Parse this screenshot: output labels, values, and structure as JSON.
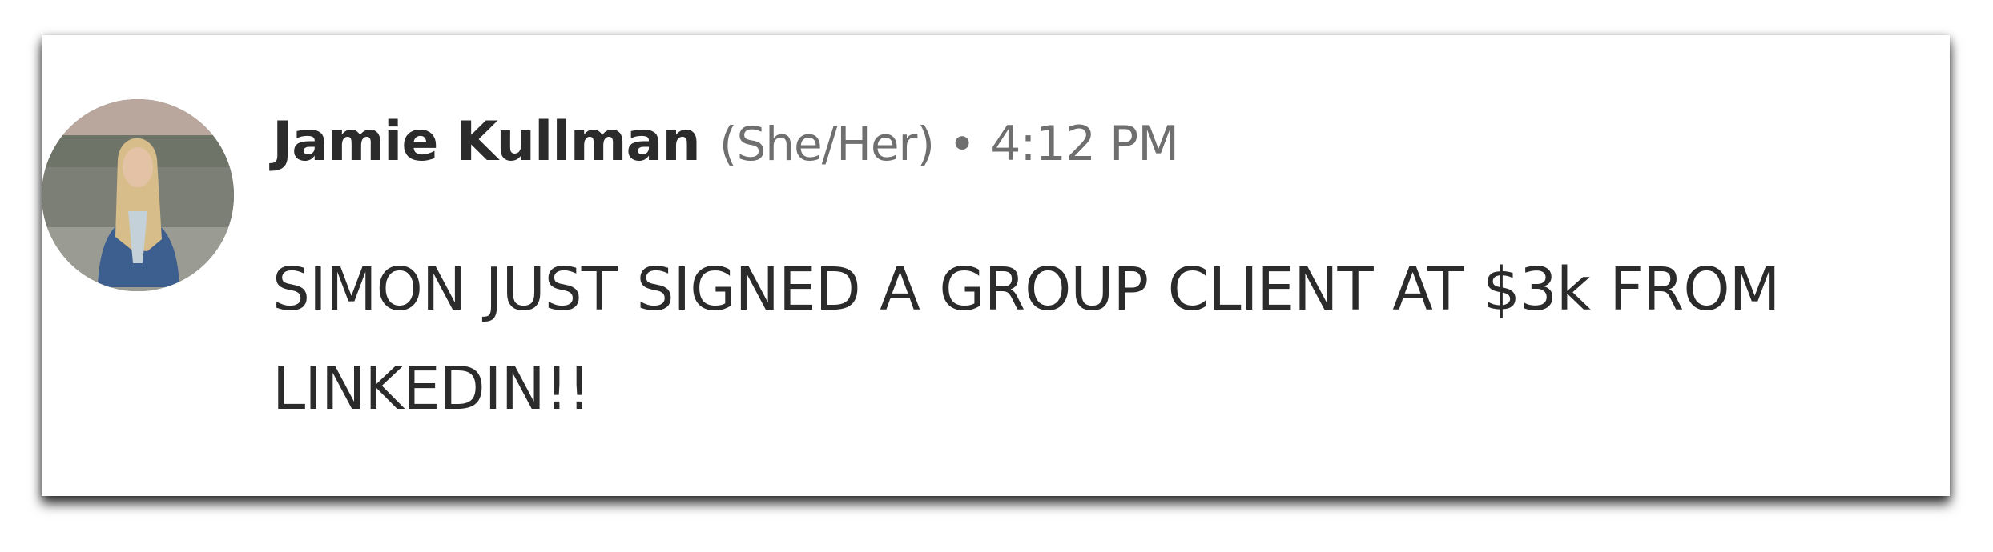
{
  "message": {
    "author": "Jamie Kullman",
    "pronouns": "(She/Her)",
    "separator": "•",
    "time": "4:12 PM",
    "text": "SIMON JUST SIGNED A GROUP CLIENT AT $3k FROM LINKEDIN!!"
  }
}
